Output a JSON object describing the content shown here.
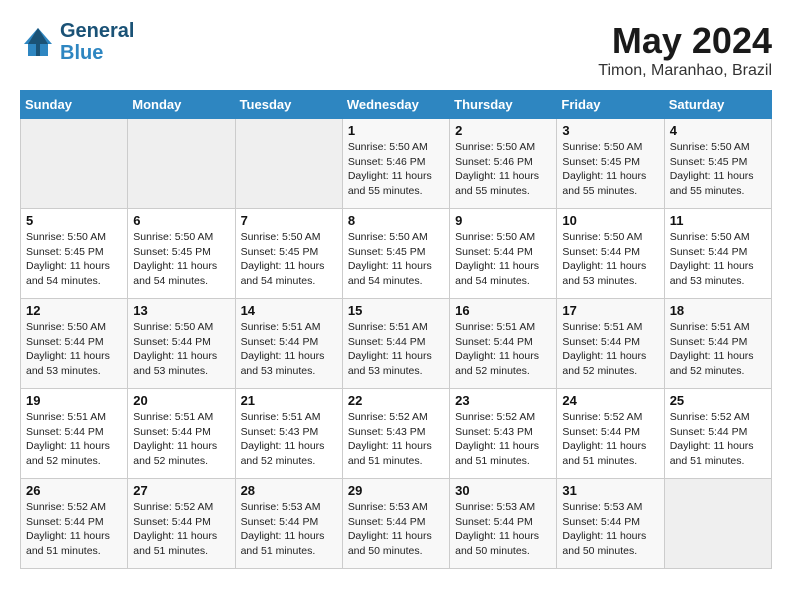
{
  "header": {
    "logo_line1": "General",
    "logo_line2": "Blue",
    "month_title": "May 2024",
    "location": "Timon, Maranhao, Brazil"
  },
  "days_of_week": [
    "Sunday",
    "Monday",
    "Tuesday",
    "Wednesday",
    "Thursday",
    "Friday",
    "Saturday"
  ],
  "weeks": [
    [
      {
        "day": "",
        "info": ""
      },
      {
        "day": "",
        "info": ""
      },
      {
        "day": "",
        "info": ""
      },
      {
        "day": "1",
        "info": "Sunrise: 5:50 AM\nSunset: 5:46 PM\nDaylight: 11 hours\nand 55 minutes."
      },
      {
        "day": "2",
        "info": "Sunrise: 5:50 AM\nSunset: 5:46 PM\nDaylight: 11 hours\nand 55 minutes."
      },
      {
        "day": "3",
        "info": "Sunrise: 5:50 AM\nSunset: 5:45 PM\nDaylight: 11 hours\nand 55 minutes."
      },
      {
        "day": "4",
        "info": "Sunrise: 5:50 AM\nSunset: 5:45 PM\nDaylight: 11 hours\nand 55 minutes."
      }
    ],
    [
      {
        "day": "5",
        "info": "Sunrise: 5:50 AM\nSunset: 5:45 PM\nDaylight: 11 hours\nand 54 minutes."
      },
      {
        "day": "6",
        "info": "Sunrise: 5:50 AM\nSunset: 5:45 PM\nDaylight: 11 hours\nand 54 minutes."
      },
      {
        "day": "7",
        "info": "Sunrise: 5:50 AM\nSunset: 5:45 PM\nDaylight: 11 hours\nand 54 minutes."
      },
      {
        "day": "8",
        "info": "Sunrise: 5:50 AM\nSunset: 5:45 PM\nDaylight: 11 hours\nand 54 minutes."
      },
      {
        "day": "9",
        "info": "Sunrise: 5:50 AM\nSunset: 5:44 PM\nDaylight: 11 hours\nand 54 minutes."
      },
      {
        "day": "10",
        "info": "Sunrise: 5:50 AM\nSunset: 5:44 PM\nDaylight: 11 hours\nand 53 minutes."
      },
      {
        "day": "11",
        "info": "Sunrise: 5:50 AM\nSunset: 5:44 PM\nDaylight: 11 hours\nand 53 minutes."
      }
    ],
    [
      {
        "day": "12",
        "info": "Sunrise: 5:50 AM\nSunset: 5:44 PM\nDaylight: 11 hours\nand 53 minutes."
      },
      {
        "day": "13",
        "info": "Sunrise: 5:50 AM\nSunset: 5:44 PM\nDaylight: 11 hours\nand 53 minutes."
      },
      {
        "day": "14",
        "info": "Sunrise: 5:51 AM\nSunset: 5:44 PM\nDaylight: 11 hours\nand 53 minutes."
      },
      {
        "day": "15",
        "info": "Sunrise: 5:51 AM\nSunset: 5:44 PM\nDaylight: 11 hours\nand 53 minutes."
      },
      {
        "day": "16",
        "info": "Sunrise: 5:51 AM\nSunset: 5:44 PM\nDaylight: 11 hours\nand 52 minutes."
      },
      {
        "day": "17",
        "info": "Sunrise: 5:51 AM\nSunset: 5:44 PM\nDaylight: 11 hours\nand 52 minutes."
      },
      {
        "day": "18",
        "info": "Sunrise: 5:51 AM\nSunset: 5:44 PM\nDaylight: 11 hours\nand 52 minutes."
      }
    ],
    [
      {
        "day": "19",
        "info": "Sunrise: 5:51 AM\nSunset: 5:44 PM\nDaylight: 11 hours\nand 52 minutes."
      },
      {
        "day": "20",
        "info": "Sunrise: 5:51 AM\nSunset: 5:44 PM\nDaylight: 11 hours\nand 52 minutes."
      },
      {
        "day": "21",
        "info": "Sunrise: 5:51 AM\nSunset: 5:43 PM\nDaylight: 11 hours\nand 52 minutes."
      },
      {
        "day": "22",
        "info": "Sunrise: 5:52 AM\nSunset: 5:43 PM\nDaylight: 11 hours\nand 51 minutes."
      },
      {
        "day": "23",
        "info": "Sunrise: 5:52 AM\nSunset: 5:43 PM\nDaylight: 11 hours\nand 51 minutes."
      },
      {
        "day": "24",
        "info": "Sunrise: 5:52 AM\nSunset: 5:44 PM\nDaylight: 11 hours\nand 51 minutes."
      },
      {
        "day": "25",
        "info": "Sunrise: 5:52 AM\nSunset: 5:44 PM\nDaylight: 11 hours\nand 51 minutes."
      }
    ],
    [
      {
        "day": "26",
        "info": "Sunrise: 5:52 AM\nSunset: 5:44 PM\nDaylight: 11 hours\nand 51 minutes."
      },
      {
        "day": "27",
        "info": "Sunrise: 5:52 AM\nSunset: 5:44 PM\nDaylight: 11 hours\nand 51 minutes."
      },
      {
        "day": "28",
        "info": "Sunrise: 5:53 AM\nSunset: 5:44 PM\nDaylight: 11 hours\nand 51 minutes."
      },
      {
        "day": "29",
        "info": "Sunrise: 5:53 AM\nSunset: 5:44 PM\nDaylight: 11 hours\nand 50 minutes."
      },
      {
        "day": "30",
        "info": "Sunrise: 5:53 AM\nSunset: 5:44 PM\nDaylight: 11 hours\nand 50 minutes."
      },
      {
        "day": "31",
        "info": "Sunrise: 5:53 AM\nSunset: 5:44 PM\nDaylight: 11 hours\nand 50 minutes."
      },
      {
        "day": "",
        "info": ""
      }
    ]
  ]
}
